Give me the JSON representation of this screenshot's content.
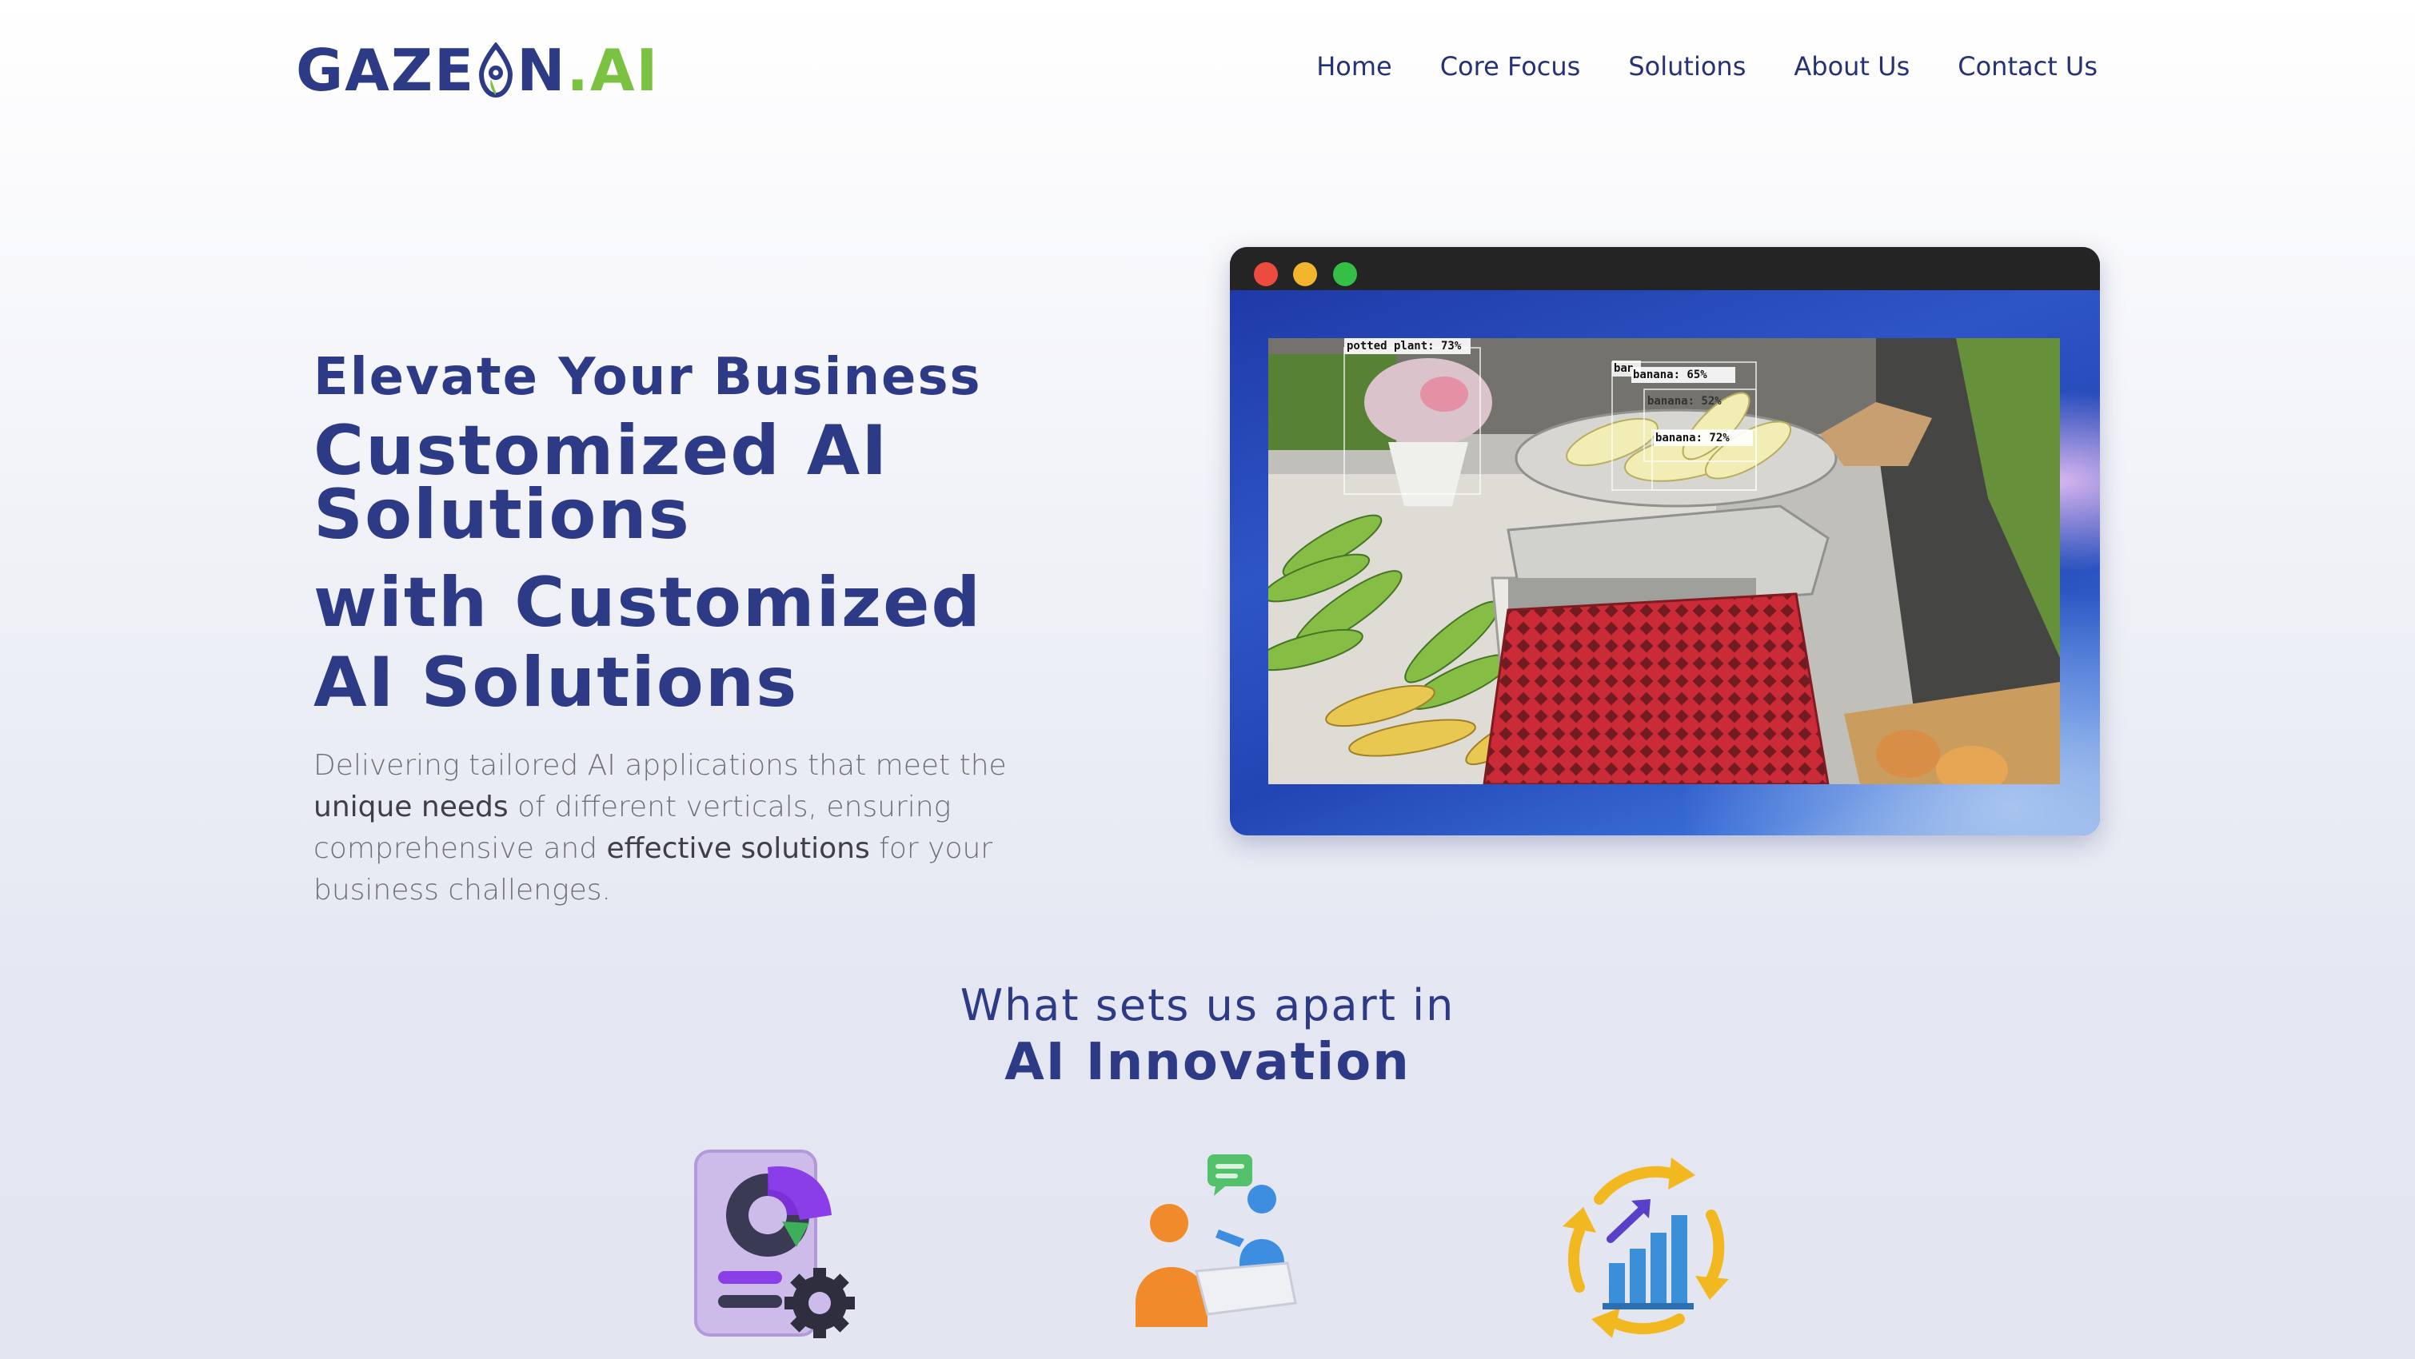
{
  "brand": {
    "logo_left": "GAZE",
    "logo_right": "N",
    "logo_dot_ai": ".AI"
  },
  "nav": {
    "items": [
      {
        "label": "Home"
      },
      {
        "label": "Core Focus"
      },
      {
        "label": "Solutions"
      },
      {
        "label": "About Us"
      },
      {
        "label": "Contact Us"
      }
    ]
  },
  "hero": {
    "eyebrow": "Elevate Your Business",
    "headline_line1": "Customized AI",
    "headline_line2": "Solutions",
    "headline2_line1": "with Customized",
    "headline2_line2": "AI Solutions",
    "description_part1": "Delivering tailored AI applications that meet the ",
    "description_bold1": "unique needs",
    "description_part2": " of different verticals, ensuring comprehensive and ",
    "description_bold2": "effective solutions",
    "description_part3": " for your business challenges."
  },
  "preview": {
    "detections": [
      {
        "label": "potted plant: 73%"
      },
      {
        "label": "ban"
      },
      {
        "label": "banana: 65%"
      },
      {
        "label": "banana: 52%"
      },
      {
        "label": "banana: 72%"
      }
    ]
  },
  "apart": {
    "line1": "What sets us apart in",
    "line2": "AI Innovation"
  },
  "features": [
    {
      "icon": "report-settings-icon"
    },
    {
      "icon": "collaboration-icon"
    },
    {
      "icon": "growth-cycle-icon"
    }
  ],
  "colors": {
    "brand_navy": "#2d3a86",
    "brand_green": "#7cc242",
    "text_gray": "#6e6f7a"
  }
}
